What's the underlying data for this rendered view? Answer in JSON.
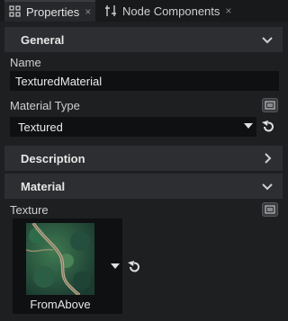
{
  "tabs": [
    {
      "label": "Properties",
      "close": "×",
      "active": true
    },
    {
      "label": "Node Components",
      "close": "×",
      "active": false
    }
  ],
  "sections": {
    "general": {
      "title": "General",
      "expanded": true
    },
    "description": {
      "title": "Description",
      "expanded": false
    },
    "material": {
      "title": "Material",
      "expanded": true
    }
  },
  "fields": {
    "name_label": "Name",
    "name_value": "TexturedMaterial",
    "material_type_label": "Material Type",
    "material_type_value": "Textured",
    "texture_label": "Texture",
    "texture_name": "FromAbove"
  },
  "icons": [
    "grid-icon",
    "properties-icon",
    "close-icon",
    "chevron-down-icon",
    "chevron-right-icon",
    "dropdown-arrow-icon",
    "revert-icon",
    "editor-icon"
  ],
  "colors": {
    "background": "#1e1f21",
    "section": "#2d2e31",
    "field": "#0f1011",
    "text": "#d6d6d6"
  }
}
